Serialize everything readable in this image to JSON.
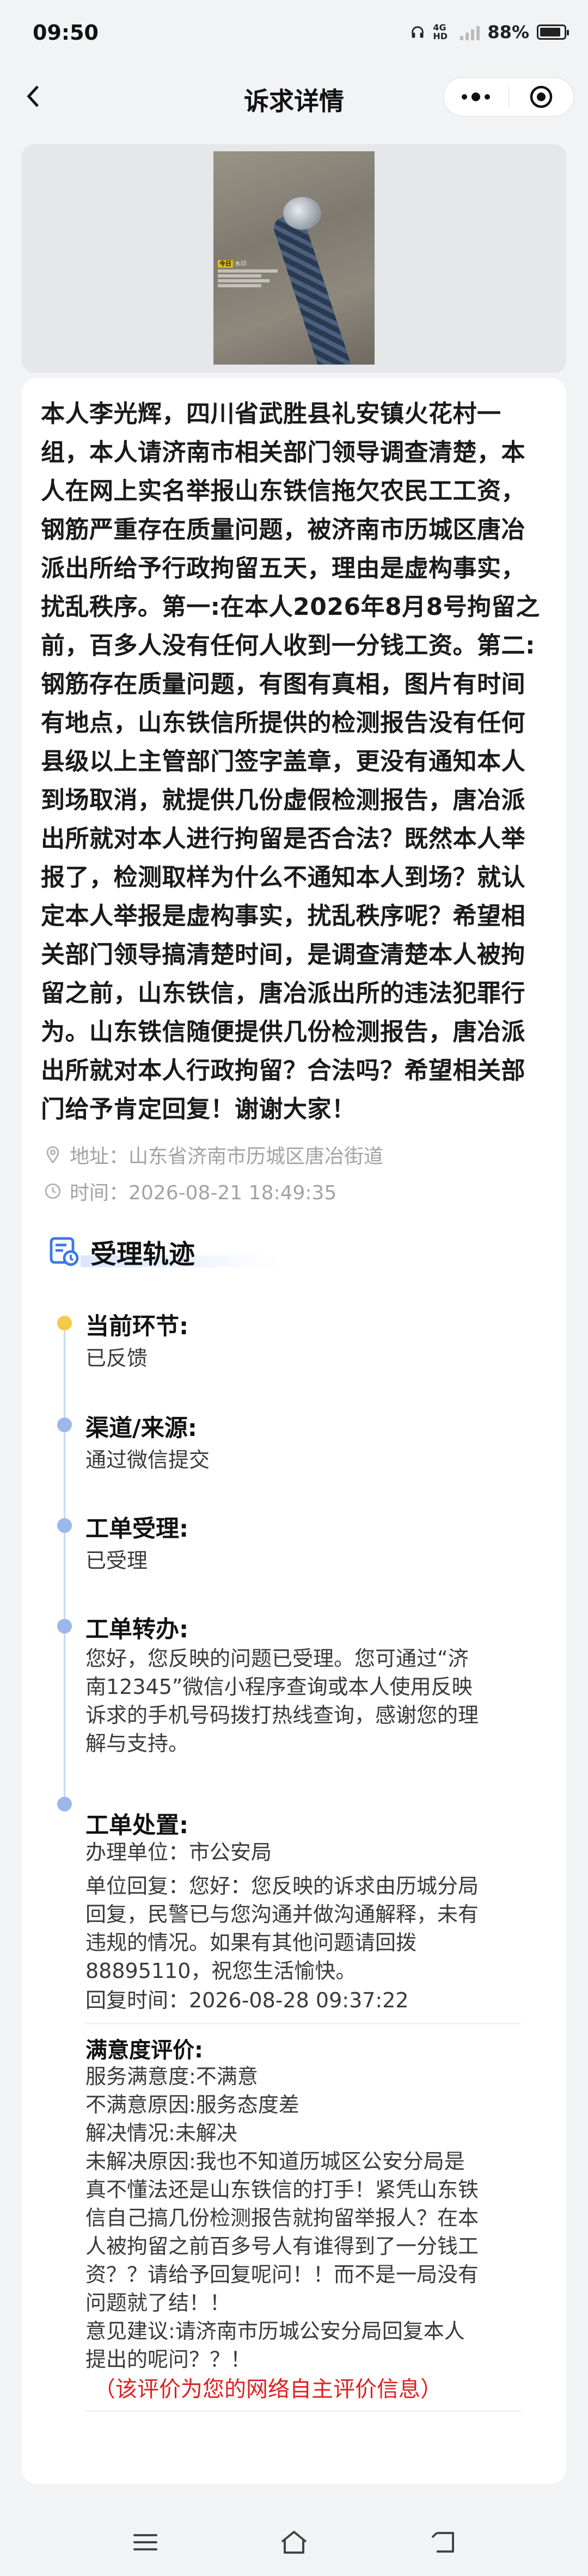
{
  "status": {
    "time": "09:50",
    "network": "4G HD",
    "battery": "88%",
    "battery_level": 0.88
  },
  "nav": {
    "title": "诉求详情"
  },
  "complaint": {
    "lines": [
      "本人李光辉，四川省武胜县礼安镇火花村一",
      "组，本人请济南市相关部门领导调查清楚，本",
      "人在网上实名举报山东铁信拖欠农民工工资，",
      "钢筋严重存在质量问题，被济南市历城区唐冶",
      "派出所给予行政拘留五天，理由是虚构事实，",
      "扰乱秩序。第一:在本人2026年8月8号拘留之",
      "前，百多人没有任何人收到一分钱工资。第二:",
      "钢筋存在质量问题，有图有真相，图片有时间",
      "有地点，山东铁信所提供的检测报告没有任何",
      "县级以上主管部门签字盖章，更没有通知本人",
      "到场取消，就提供几份虚假检测报告，唐冶派",
      "出所就对本人进行拘留是否合法？既然本人举",
      "报了，检测取样为什么不通知本人到场？就认",
      "定本人举报是虚构事实，扰乱秩序呢？希望相",
      "关部门领导搞清楚时间，是调查清楚本人被拘",
      "留之前，山东铁信，唐冶派出所的违法犯罪行",
      "为。山东铁信随便提供几份检测报告，唐冶派",
      "出所就对本人行政拘留？合法吗？希望相关部",
      "门给予肯定回复！谢谢大家！"
    ],
    "address": "地址：山东省济南市历城区唐冶街道",
    "time": "时间：2026-08-21 18:49:35"
  },
  "track": {
    "section_title": "受理轨迹",
    "current": {
      "title": "当前环节:",
      "value": "已反馈"
    },
    "channel": {
      "title": "渠道/来源:",
      "value": "通过微信提交"
    },
    "accept": {
      "title": "工单受理:",
      "value": "已受理"
    },
    "transfer": {
      "title": "工单转办:",
      "lines": [
        "您好，您反映的问题已受理。您可通过“济",
        "南12345”微信小程序查询或本人使用反映",
        "诉求的手机号码拨打热线查询，感谢您的理",
        "解与支持。"
      ]
    },
    "handle": {
      "title": "工单处置:",
      "unit": "办理单位：市公安局",
      "reply_lines": [
        "单位回复：您好：您反映的诉求由历城分局",
        "回复，民警已与您沟通并做沟通解释，未有",
        "违规的情况。如果有其他问题请回拨",
        "88895110，祝您生活愉快。"
      ],
      "reply_time": "回复时间：2026-08-28 09:37:22"
    },
    "evaluation": {
      "title": "满意度评价:",
      "satisfaction": "服务满意度:不满意",
      "reason": "不满意原因:服务态度差",
      "resolution": "解决情况:未解决",
      "unresolved_lines": [
        "未解决原因:我也不知道历城区公安分局是",
        "真不懂法还是山东铁信的打手！紧凭山东铁",
        "信自己搞几份检测报告就拘留举报人？在本",
        "人被拘留之前百多号人有谁得到了一分钱工",
        "资？？请给予回复呢问！！而不是一局没有",
        "问题就了结！！"
      ],
      "suggestion_lines": [
        "意见建议:请济南市历城公安分局回复本人",
        "提出的呢问？？！"
      ],
      "note": "（该评价为您的网络自主评价信息）"
    }
  },
  "colors": {
    "accent": "#e02020",
    "timeline": "#9bb7ec",
    "current": "#f7c948"
  }
}
